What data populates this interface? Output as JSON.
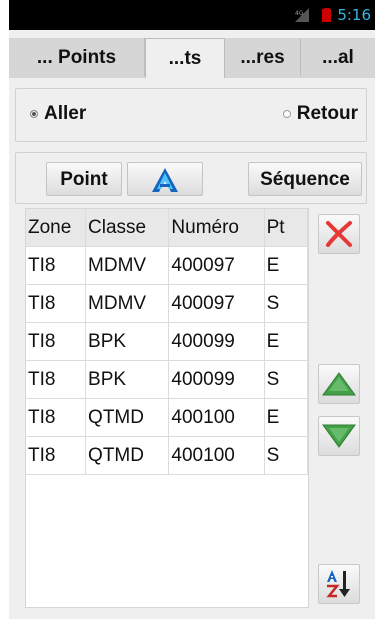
{
  "status_bar": {
    "time": "5:16",
    "signal_icon": "signal-icon",
    "battery_icon": "battery-icon"
  },
  "tabs": [
    {
      "label": "... Points",
      "active": false
    },
    {
      "label": "...ts",
      "active": true
    },
    {
      "label": "...res",
      "active": false
    },
    {
      "label": "...al",
      "active": false
    }
  ],
  "direction": {
    "aller_label": "Aller",
    "retour_label": "Retour",
    "selected": "Aller"
  },
  "buttons": {
    "point_label": "Point",
    "a_icon": "a-letter-icon",
    "sequence_label": "Séquence"
  },
  "table": {
    "headers": [
      "Zone",
      "Classe",
      "Numéro",
      "Pt"
    ],
    "rows": [
      [
        "TI8",
        "MDMV",
        "400097",
        "E"
      ],
      [
        "TI8",
        "MDMV",
        "400097",
        "S"
      ],
      [
        "TI8",
        "BPK",
        "400099",
        "E"
      ],
      [
        "TI8",
        "BPK",
        "400099",
        "S"
      ],
      [
        "TI8",
        "QTMD",
        "400100",
        "E"
      ],
      [
        "TI8",
        "QTMD",
        "400100",
        "S"
      ]
    ]
  },
  "side_buttons": {
    "delete_icon": "delete-x-icon",
    "up_icon": "arrow-up-icon",
    "down_icon": "arrow-down-icon",
    "sort_icon": "sort-az-icon"
  },
  "colors": {
    "accent_blue": "#33b5e5",
    "delete_red": "#e53935",
    "arrow_green": "#43a047"
  }
}
